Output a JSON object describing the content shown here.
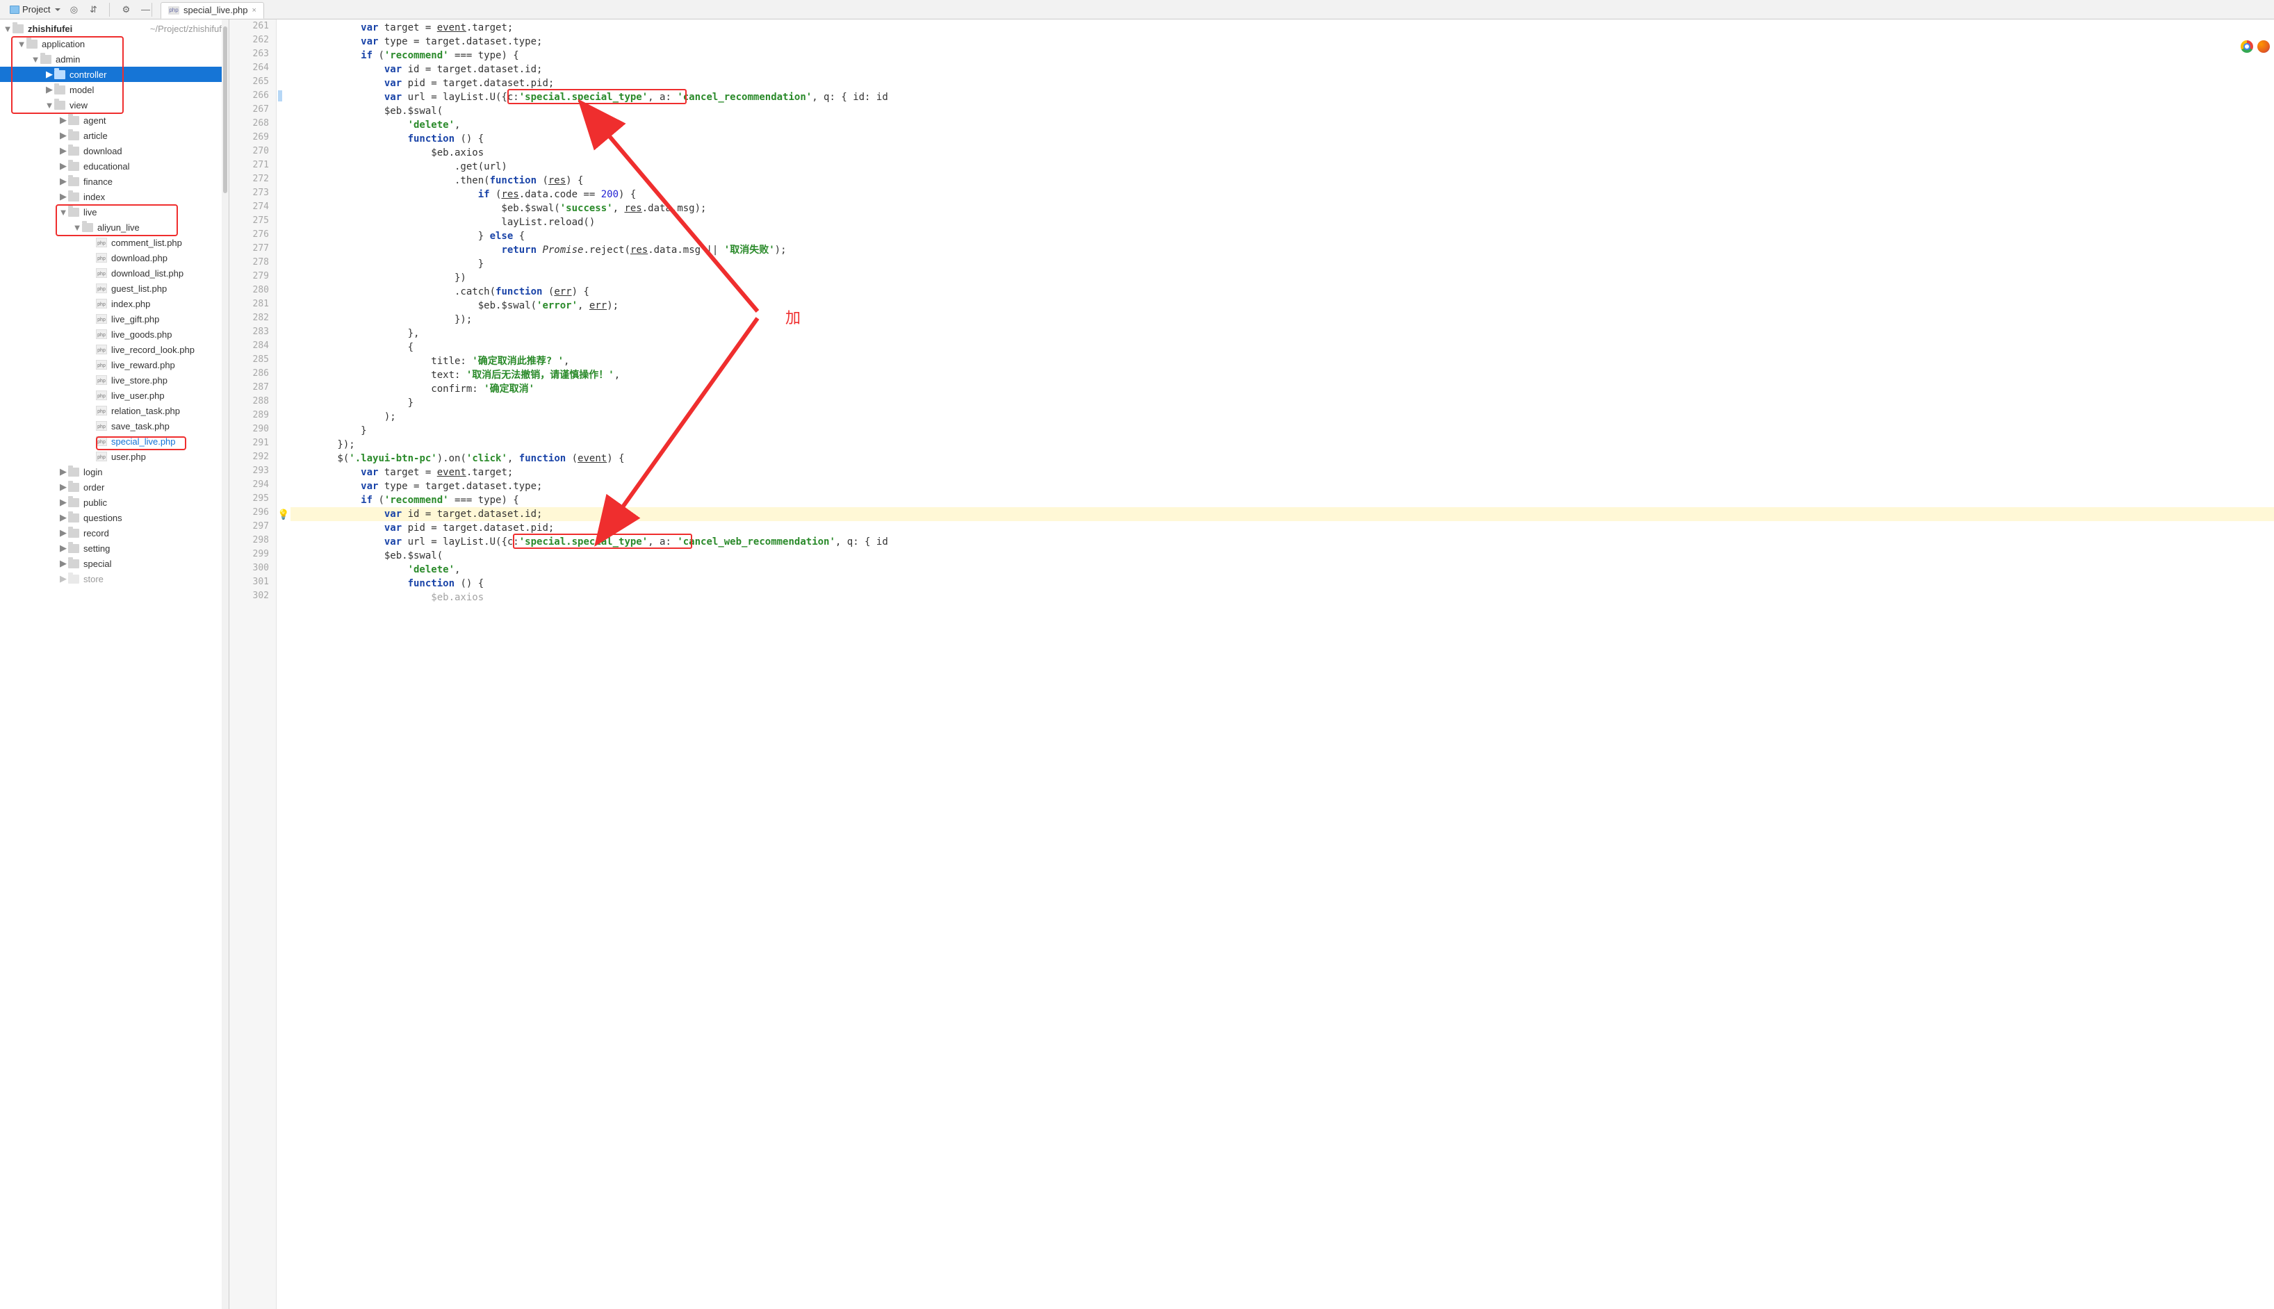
{
  "toolbar": {
    "project_label": "Project",
    "icons": [
      "target-icon",
      "collapse-icon",
      "gear-icon",
      "minimize-icon"
    ]
  },
  "tab": {
    "filename": "special_live.php",
    "filetype": "php"
  },
  "project_root": {
    "name": "zhishifufei",
    "path": "~/Project/zhishifufei"
  },
  "tree": [
    {
      "name": "application",
      "type": "folder",
      "indent": 1,
      "arrow": "down"
    },
    {
      "name": "admin",
      "type": "folder",
      "indent": 2,
      "arrow": "down"
    },
    {
      "name": "controller",
      "type": "folder",
      "indent": 3,
      "arrow": "right",
      "selected": true
    },
    {
      "name": "model",
      "type": "folder",
      "indent": 3,
      "arrow": "right"
    },
    {
      "name": "view",
      "type": "folder",
      "indent": 3,
      "arrow": "down"
    },
    {
      "name": "agent",
      "type": "folder",
      "indent": 4,
      "arrow": "right"
    },
    {
      "name": "article",
      "type": "folder",
      "indent": 4,
      "arrow": "right"
    },
    {
      "name": "download",
      "type": "folder",
      "indent": 4,
      "arrow": "right"
    },
    {
      "name": "educational",
      "type": "folder",
      "indent": 4,
      "arrow": "right"
    },
    {
      "name": "finance",
      "type": "folder",
      "indent": 4,
      "arrow": "right"
    },
    {
      "name": "index",
      "type": "folder",
      "indent": 4,
      "arrow": "right"
    },
    {
      "name": "live",
      "type": "folder",
      "indent": 4,
      "arrow": "down"
    },
    {
      "name": "aliyun_live",
      "type": "folder",
      "indent": 5,
      "arrow": "down"
    },
    {
      "name": "comment_list.php",
      "type": "file",
      "indent": 6,
      "ext": "php"
    },
    {
      "name": "download.php",
      "type": "file",
      "indent": 6,
      "ext": "php"
    },
    {
      "name": "download_list.php",
      "type": "file",
      "indent": 6,
      "ext": "php"
    },
    {
      "name": "guest_list.php",
      "type": "file",
      "indent": 6,
      "ext": "php"
    },
    {
      "name": "index.php",
      "type": "file",
      "indent": 6,
      "ext": "php"
    },
    {
      "name": "live_gift.php",
      "type": "file",
      "indent": 6,
      "ext": "php"
    },
    {
      "name": "live_goods.php",
      "type": "file",
      "indent": 6,
      "ext": "php"
    },
    {
      "name": "live_record_look.php",
      "type": "file",
      "indent": 6,
      "ext": "php"
    },
    {
      "name": "live_reward.php",
      "type": "file",
      "indent": 6,
      "ext": "php"
    },
    {
      "name": "live_store.php",
      "type": "file",
      "indent": 6,
      "ext": "php"
    },
    {
      "name": "live_user.php",
      "type": "file",
      "indent": 6,
      "ext": "php"
    },
    {
      "name": "relation_task.php",
      "type": "file",
      "indent": 6,
      "ext": "php"
    },
    {
      "name": "save_task.php",
      "type": "file",
      "indent": 6,
      "ext": "php"
    },
    {
      "name": "special_live.php",
      "type": "file",
      "indent": 6,
      "ext": "php",
      "file_selected": true
    },
    {
      "name": "user.php",
      "type": "file",
      "indent": 6,
      "ext": "php"
    },
    {
      "name": "login",
      "type": "folder",
      "indent": 4,
      "arrow": "right"
    },
    {
      "name": "order",
      "type": "folder",
      "indent": 4,
      "arrow": "right"
    },
    {
      "name": "public",
      "type": "folder",
      "indent": 4,
      "arrow": "right"
    },
    {
      "name": "questions",
      "type": "folder",
      "indent": 4,
      "arrow": "right"
    },
    {
      "name": "record",
      "type": "folder",
      "indent": 4,
      "arrow": "right"
    },
    {
      "name": "setting",
      "type": "folder",
      "indent": 4,
      "arrow": "right"
    },
    {
      "name": "special",
      "type": "folder",
      "indent": 4,
      "arrow": "right"
    },
    {
      "name": "store",
      "type": "folder",
      "indent": 4,
      "arrow": "right",
      "faded": true
    }
  ],
  "gutter": {
    "start": 261,
    "end": 302
  },
  "code_lines": [
    {
      "n": 261,
      "raw": "            var target = event.target;"
    },
    {
      "n": 262,
      "raw": "            var type = target.dataset.type;"
    },
    {
      "n": 263,
      "raw": "            if ('recommend' === type) {"
    },
    {
      "n": 264,
      "raw": "                var id = target.dataset.id;"
    },
    {
      "n": 265,
      "raw": "                var pid = target.dataset.pid;"
    },
    {
      "n": 266,
      "raw": "                var url = layList.U({c:'special.special_type', a: 'cancel_recommendation', q: { id: id"
    },
    {
      "n": 267,
      "raw": "                $eb.$swal("
    },
    {
      "n": 268,
      "raw": "                    'delete',"
    },
    {
      "n": 269,
      "raw": "                    function () {"
    },
    {
      "n": 270,
      "raw": "                        $eb.axios"
    },
    {
      "n": 271,
      "raw": "                            .get(url)"
    },
    {
      "n": 272,
      "raw": "                            .then(function (res) {"
    },
    {
      "n": 273,
      "raw": "                                if (res.data.code == 200) {"
    },
    {
      "n": 274,
      "raw": "                                    $eb.$swal('success', res.data.msg);"
    },
    {
      "n": 275,
      "raw": "                                    layList.reload()"
    },
    {
      "n": 276,
      "raw": "                                } else {"
    },
    {
      "n": 277,
      "raw": "                                    return Promise.reject(res.data.msg || '取消失败');"
    },
    {
      "n": 278,
      "raw": "                                }"
    },
    {
      "n": 279,
      "raw": "                            })"
    },
    {
      "n": 280,
      "raw": "                            .catch(function (err) {"
    },
    {
      "n": 281,
      "raw": "                                $eb.$swal('error', err);"
    },
    {
      "n": 282,
      "raw": "                            });"
    },
    {
      "n": 283,
      "raw": "                    },"
    },
    {
      "n": 284,
      "raw": "                    {"
    },
    {
      "n": 285,
      "raw": "                        title: '确定取消此推荐? ',"
    },
    {
      "n": 286,
      "raw": "                        text: '取消后无法撤销，请谨慎操作！',"
    },
    {
      "n": 287,
      "raw": "                        confirm: '确定取消'"
    },
    {
      "n": 288,
      "raw": "                    }"
    },
    {
      "n": 289,
      "raw": "                );"
    },
    {
      "n": 290,
      "raw": "            }"
    },
    {
      "n": 291,
      "raw": "        });"
    },
    {
      "n": 292,
      "raw": "        $('.layui-btn-pc').on('click', function (event) {"
    },
    {
      "n": 293,
      "raw": "            var target = event.target;"
    },
    {
      "n": 294,
      "raw": "            var type = target.dataset.type;"
    },
    {
      "n": 295,
      "raw": "            if ('recommend' === type) {"
    },
    {
      "n": 296,
      "raw": "                var id = target.dataset.id;",
      "hl": true,
      "bulb": true
    },
    {
      "n": 297,
      "raw": "                var pid = target.dataset.pid;"
    },
    {
      "n": 298,
      "raw": "                var url = layList.U({c:'special.special_type', a: 'cancel_web_recommendation', q: { id"
    },
    {
      "n": 299,
      "raw": "                $eb.$swal("
    },
    {
      "n": 300,
      "raw": "                    'delete',"
    },
    {
      "n": 301,
      "raw": "                    function () {"
    },
    {
      "n": 302,
      "raw": "                        $eb.axios",
      "faded": true
    }
  ],
  "annotations": {
    "red_boxes_sidebar": [
      {
        "desc": "application/admin/controller/model/view block"
      },
      {
        "desc": "live/aliyun_live block"
      },
      {
        "desc": "special_live.php file"
      }
    ],
    "red_boxes_code": [
      {
        "line": 266,
        "text": "{c:'special.special_type',"
      },
      {
        "line": 298,
        "text": "{c:'special.special_type',"
      }
    ],
    "center_label": "加"
  },
  "php_badge_text": "php"
}
